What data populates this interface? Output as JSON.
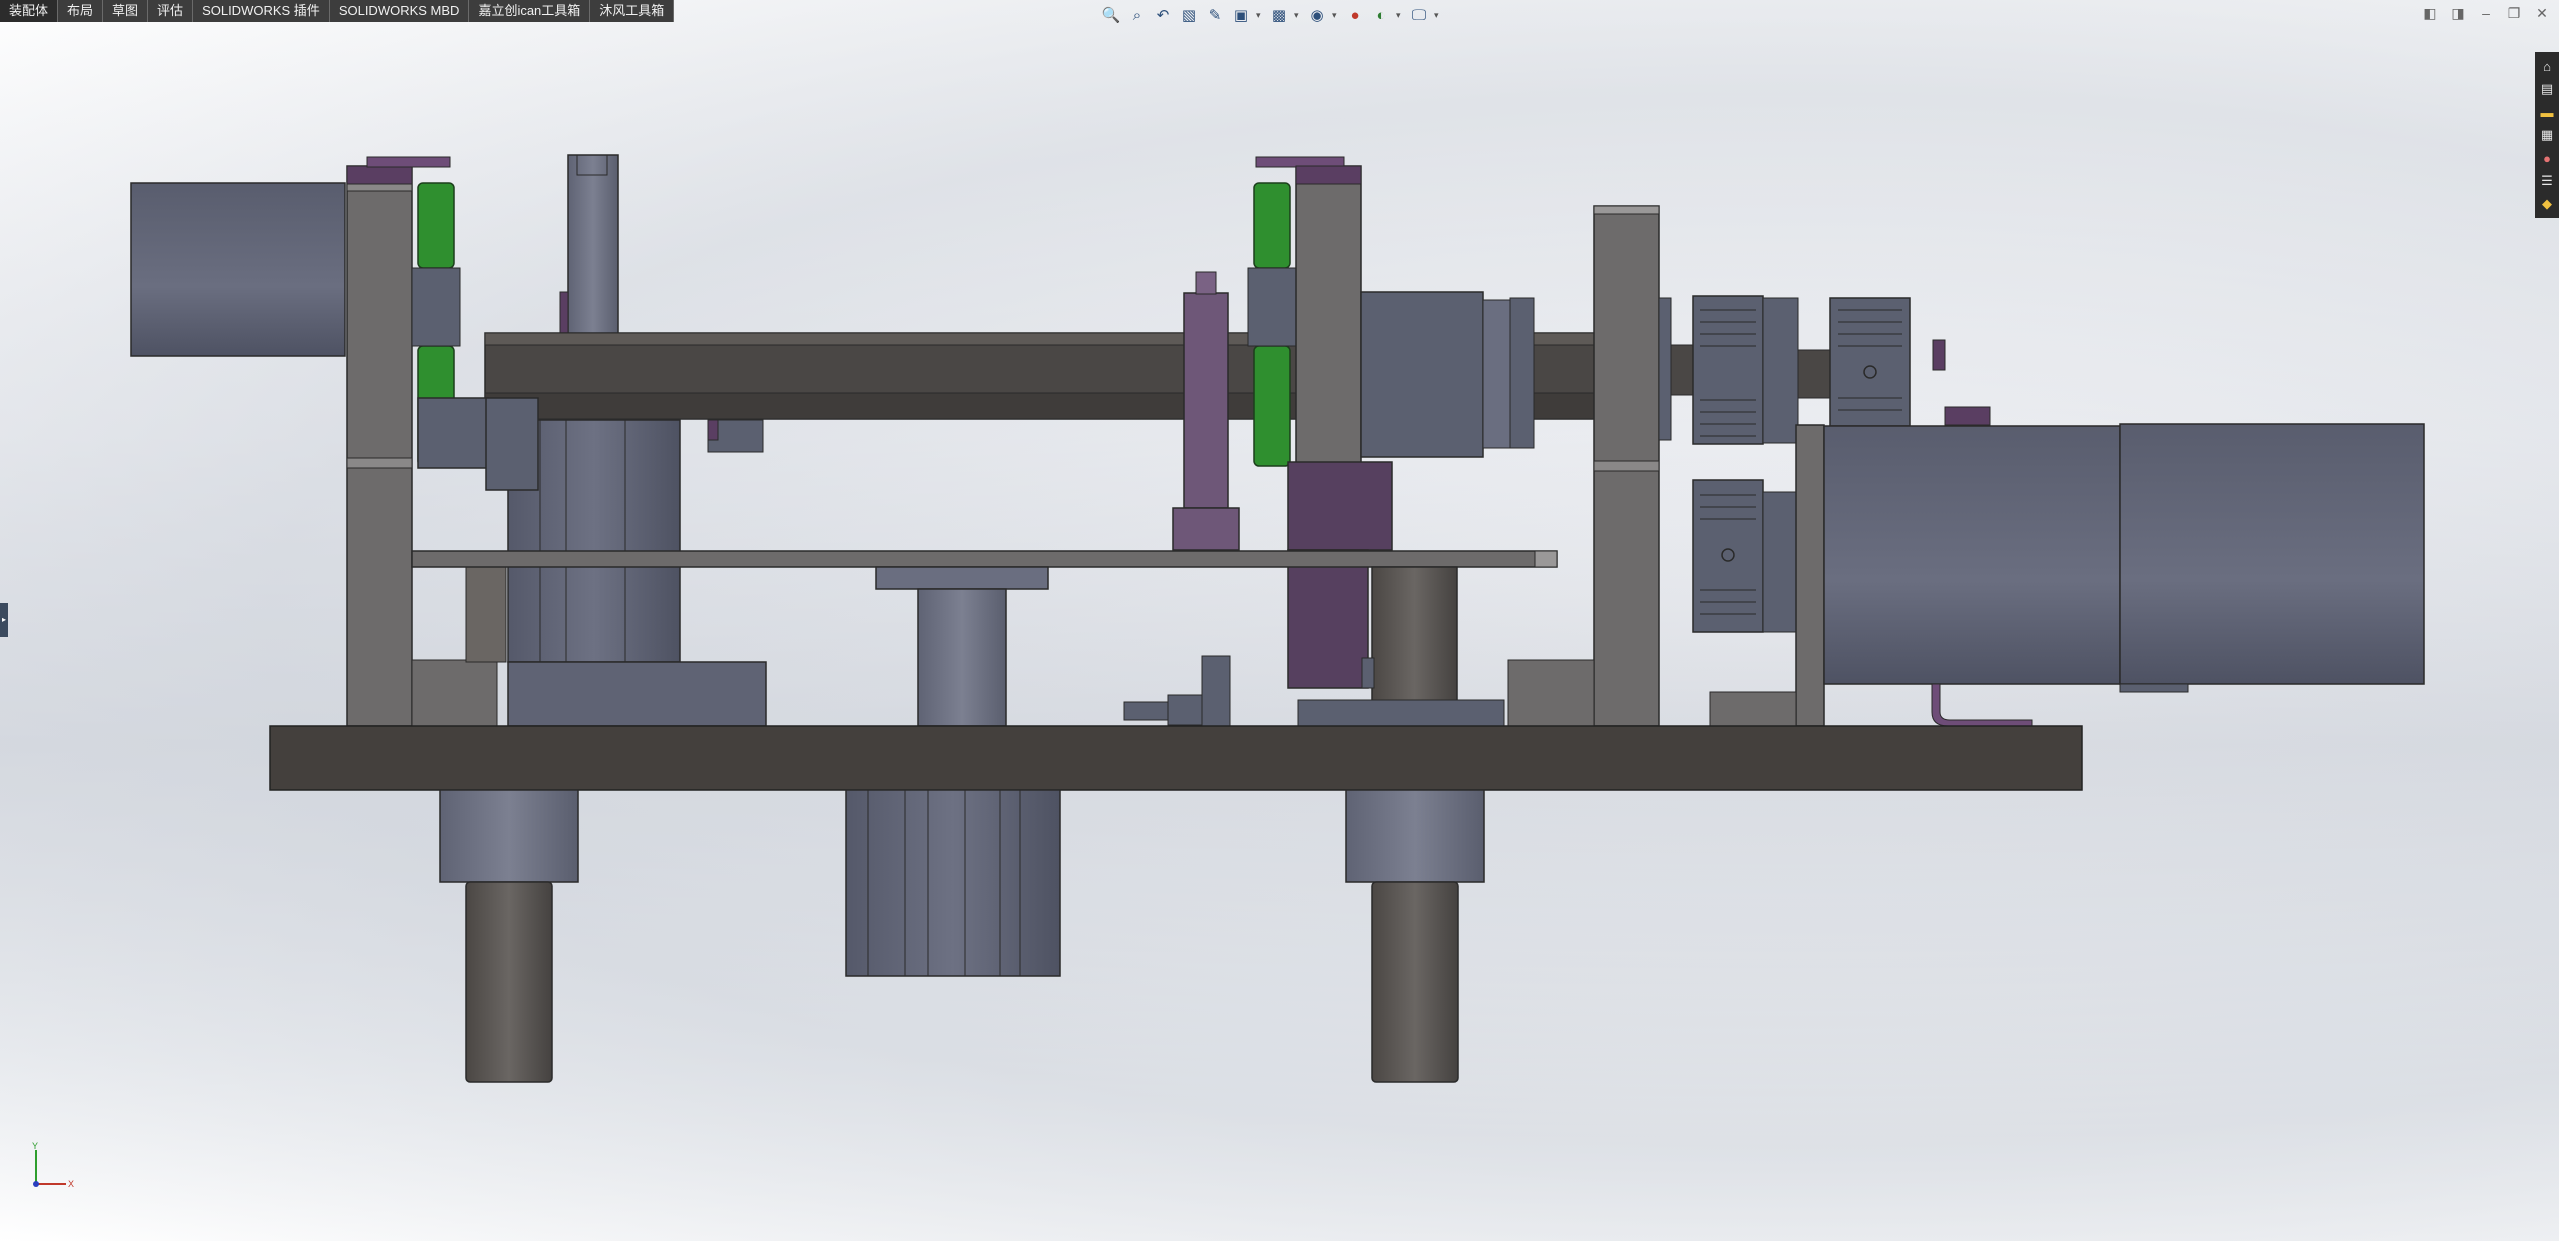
{
  "command_manager": {
    "tabs": [
      {
        "label": "装配体"
      },
      {
        "label": "布局"
      },
      {
        "label": "草图"
      },
      {
        "label": "评估"
      },
      {
        "label": "SOLIDWORKS 插件"
      },
      {
        "label": "SOLIDWORKS MBD"
      },
      {
        "label": "嘉立创ican工具箱"
      },
      {
        "label": "沐风工具箱"
      }
    ],
    "active_tab": 0
  },
  "heads_up_toolbar": {
    "icons": [
      "zoom-to-fit-icon",
      "zoom-to-area-icon",
      "previous-view-icon",
      "section-view-icon",
      "dynamic-annotation-icon",
      "view-orientation-icon",
      "display-style-icon",
      "hide-show-items-icon",
      "edit-appearance-icon",
      "apply-scene-icon",
      "view-settings-icon"
    ]
  },
  "window_controls": {
    "icons": [
      "tile-left-icon",
      "tile-right-icon",
      "minimize-icon",
      "restore-icon",
      "close-icon"
    ]
  },
  "task_pane": {
    "icons": [
      "solidworks-resources-icon",
      "design-library-icon",
      "file-explorer-icon",
      "view-palette-icon",
      "appearances-icon",
      "custom-properties-icon",
      "solidworks-forum-icon"
    ]
  },
  "triad": {
    "x_label": "X",
    "y_label": "Y"
  },
  "colors": {
    "tab_bar_bg": "#3d3d3d",
    "steel_dark": "#4a4745",
    "steel_mid": "#6e6c6c",
    "blue_grey": "#5b6070",
    "purple": "#5a3e62",
    "green": "#2b8a2b"
  }
}
